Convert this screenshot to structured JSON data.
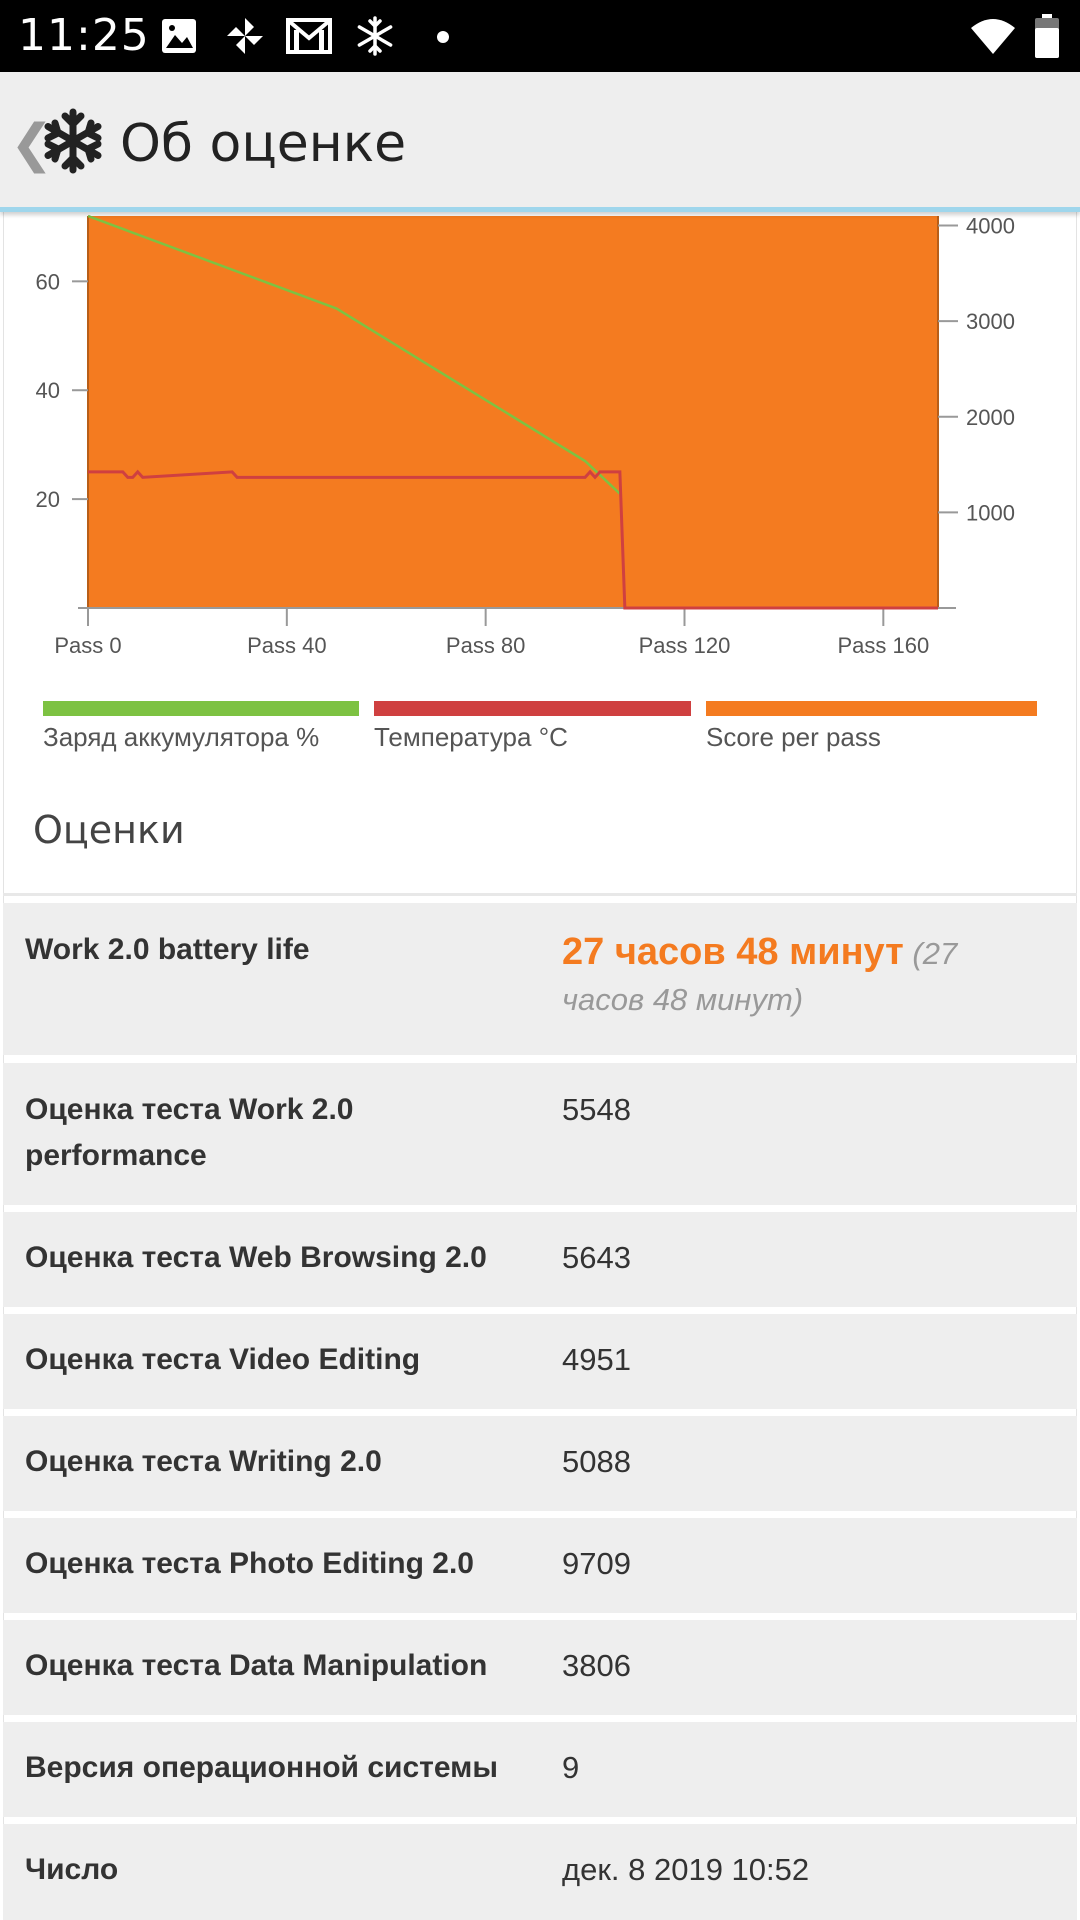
{
  "status_bar": {
    "time": "11:25",
    "icons": [
      "image-icon",
      "pinwheel-icon",
      "gmail-icon",
      "snowflake-icon",
      "dot-icon",
      "wifi-icon",
      "battery-icon"
    ]
  },
  "app_bar": {
    "title": "Об оценке",
    "back_icon": "chevron-left-icon",
    "logo_icon": "snowflake-icon"
  },
  "chart": {
    "x_ticks": [
      "Pass 0",
      "Pass 40",
      "Pass 80",
      "Pass 120",
      "Pass 160"
    ],
    "y_left_ticks": [
      "20",
      "40",
      "60"
    ],
    "y_right_ticks": [
      "1000",
      "2000",
      "3000",
      "4000"
    ],
    "legend": [
      {
        "label": "Заряд аккумулятора %",
        "color": "#7dc242"
      },
      {
        "label": "Температура °C",
        "color": "#cf4040"
      },
      {
        "label": "Score per pass",
        "color": "#f47b20"
      }
    ]
  },
  "chart_data": {
    "type": "line",
    "xlabel": "",
    "ylabel": "",
    "x_ticks": [
      "Pass 0",
      "Pass 40",
      "Pass 80",
      "Pass 120",
      "Pass 160"
    ],
    "xlim": [
      0,
      171
    ],
    "ylim_left": [
      0,
      72
    ],
    "ylim_right": [
      0,
      4100
    ],
    "legend_position": "bottom",
    "grid": false,
    "series": [
      {
        "name": "Заряд аккумулятора %",
        "axis": "left",
        "color": "#7dc242",
        "x": [
          0,
          50,
          100,
          107
        ],
        "y": [
          72,
          55,
          27,
          21
        ]
      },
      {
        "name": "Температура °C",
        "axis": "left",
        "color": "#cf4040",
        "x": [
          0,
          7,
          8,
          9,
          10,
          11,
          29,
          30,
          100,
          101,
          102,
          103,
          107,
          108,
          171
        ],
        "y": [
          25,
          25,
          24,
          24,
          25,
          24,
          25,
          24,
          24,
          25,
          24,
          25,
          25,
          0,
          0
        ]
      },
      {
        "name": "Score per pass",
        "axis": "right",
        "type": "area",
        "color": "#f47b20",
        "x": [
          0,
          171
        ],
        "y": [
          4100,
          4100
        ]
      }
    ]
  },
  "scores": {
    "heading": "Оценки",
    "battery": {
      "name": "Work 2.0 battery life",
      "value": "27 часов 48 минут",
      "value_detail": "(27 часов 48 минут)"
    },
    "rows": [
      {
        "name": "Оценка теста Work 2.0 performance",
        "value": "5548"
      },
      {
        "name": "Оценка теста Web Browsing 2.0",
        "value": "5643"
      },
      {
        "name": "Оценка теста Video Editing",
        "value": "4951"
      },
      {
        "name": "Оценка теста Writing 2.0",
        "value": "5088"
      },
      {
        "name": "Оценка теста Photo Editing 2.0",
        "value": "9709"
      },
      {
        "name": "Оценка теста Data Manipulation",
        "value": "3806"
      },
      {
        "name": "Версия операционной системы",
        "value": "9"
      },
      {
        "name": "Число",
        "value": "дек. 8 2019 10:52"
      }
    ]
  }
}
